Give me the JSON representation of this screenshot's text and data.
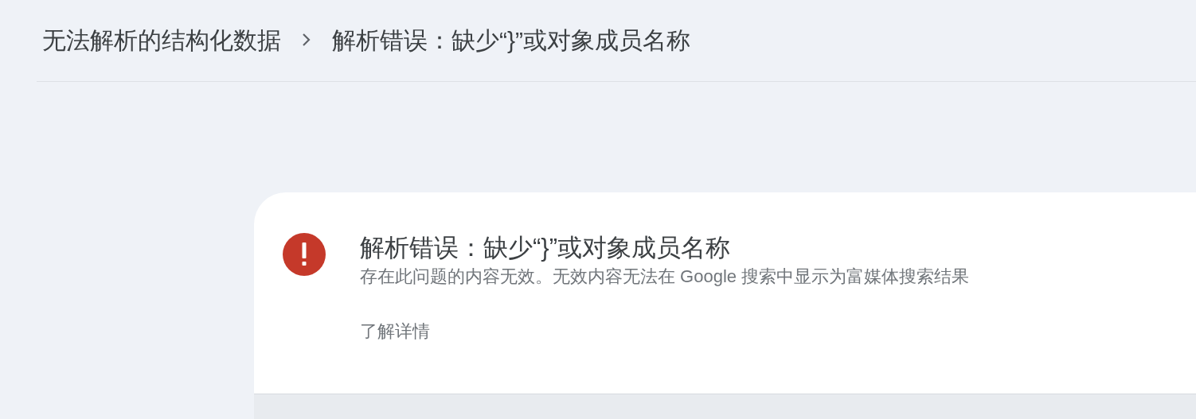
{
  "breadcrumb": [
    {
      "label": "无法解析的结构化数据"
    },
    {
      "label": "解析错误：缺少“}”或对象成员名称"
    }
  ],
  "issue": {
    "title": "解析错误：缺少“}”或对象成员名称",
    "description": "存在此问题的内容无效。无效内容无法在 Google 搜索中显示为富媒体搜索结果",
    "link": "了解详情"
  }
}
